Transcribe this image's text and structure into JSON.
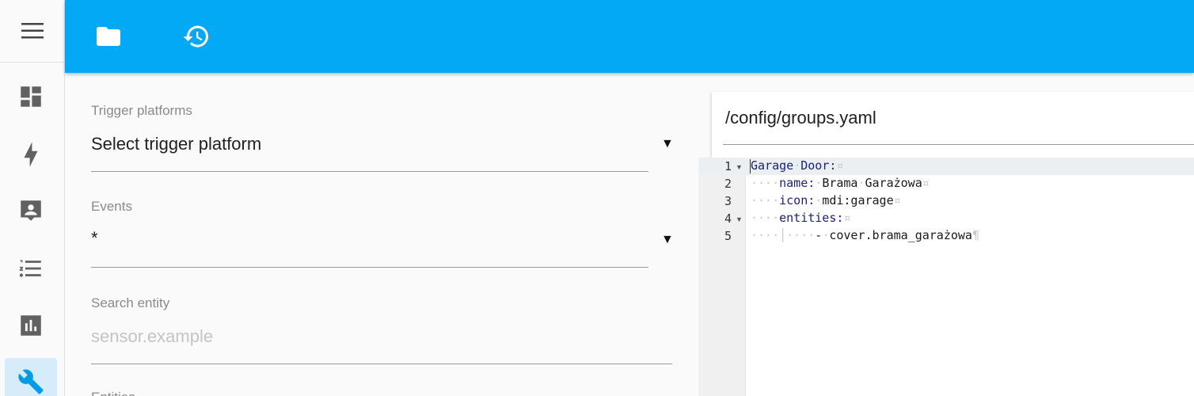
{
  "sidebar": {
    "items": [
      {
        "name": "menu",
        "icon": "hamburger-menu-icon"
      },
      {
        "name": "overview",
        "icon": "dashboard-icon"
      },
      {
        "name": "logbook",
        "icon": "lightning-bolt-icon"
      },
      {
        "name": "map",
        "icon": "account-box-icon"
      },
      {
        "name": "list",
        "icon": "format-list-icon"
      },
      {
        "name": "history",
        "icon": "chart-bar-icon"
      },
      {
        "name": "configuration",
        "icon": "wrench-icon",
        "active": true
      }
    ]
  },
  "topbar": {
    "icons": [
      "folder-icon",
      "history-icon"
    ],
    "color": "#03a9f4"
  },
  "form": {
    "trigger": {
      "label": "Trigger platforms",
      "value": "Select trigger platform"
    },
    "events": {
      "label": "Events",
      "value": "*"
    },
    "search": {
      "label": "Search entity",
      "placeholder": "sensor.example"
    },
    "entities": {
      "label": "Entities"
    }
  },
  "editor": {
    "path": "/config/groups.yaml",
    "lines": [
      {
        "num": "1"
      },
      {
        "num": "2"
      },
      {
        "num": "3"
      },
      {
        "num": "4"
      },
      {
        "num": "5"
      }
    ],
    "code": {
      "l1_key": "Garage",
      "l1_key2": "Door:",
      "l2_key": "name:",
      "l2_v1": "Brama",
      "l2_v2": "Garażowa",
      "l3_key": "icon:",
      "l3_val": "mdi:garage",
      "l4_key": "entities:",
      "l5_dash": "-",
      "l5_val": "cover.brama_garażowa"
    }
  }
}
